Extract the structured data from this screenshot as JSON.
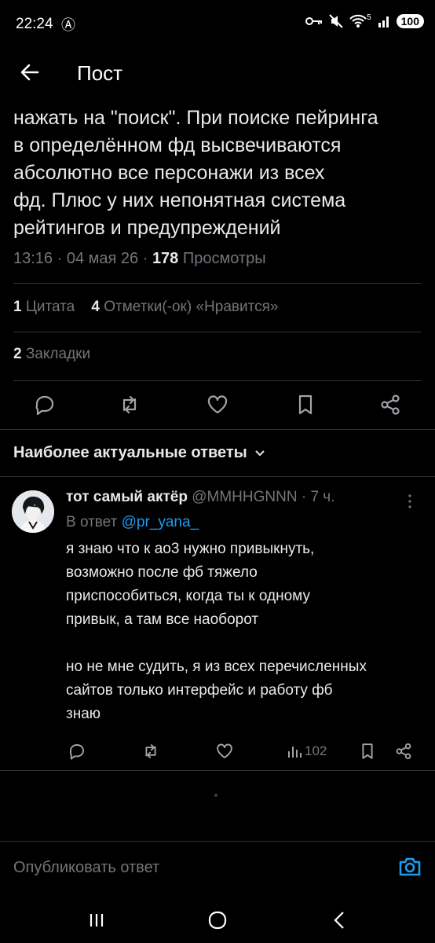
{
  "status": {
    "time": "22:24",
    "anarchy_icon": "Ⓐ",
    "battery": "100",
    "wifi_mark": "5"
  },
  "header": {
    "title": "Пост"
  },
  "tweet": {
    "lines": [
      "нажать на \"поиск\". При поиске пейринга",
      "в определённом фд высвечиваются",
      "абсолютно все персонажи из всех",
      "фд. Плюс у них непонятная система",
      "рейтингов и предупреждений"
    ],
    "time": "13:16",
    "date": "04 мая 26",
    "views_count": "178",
    "views_label": "Просмотры",
    "quotes_count": "1",
    "quotes_label": "Цитата",
    "likes_count": "4",
    "likes_label": "Отметки(-ок) «Нравится»",
    "bookmarks_count": "2",
    "bookmarks_label": "Закладки"
  },
  "replies_section": {
    "title": "Наиболее актуальные ответы"
  },
  "reply": {
    "name": "тот самый актёр",
    "handle": "@MMHHGNNN",
    "age": "7 ч.",
    "in_reply_prefix": "В ответ",
    "in_reply_to": "@pr_yana_",
    "lines": [
      "я знаю что к ао3 нужно привыкнуть,",
      "возможно после фб тяжело",
      "приспособиться, когда ты к одному",
      "привык, а там все наоборот",
      "",
      "но не мне судить, я из всех перечисленных",
      "сайтов только интерфейс и работу фб",
      "знаю"
    ],
    "views": "102"
  },
  "compose": {
    "placeholder": "Опубликовать ответ"
  },
  "colors": {
    "background": "#000000",
    "text": "#e7e9ea",
    "muted": "#71767b",
    "accent": "#1d9bf0",
    "divider": "#2f3336"
  }
}
